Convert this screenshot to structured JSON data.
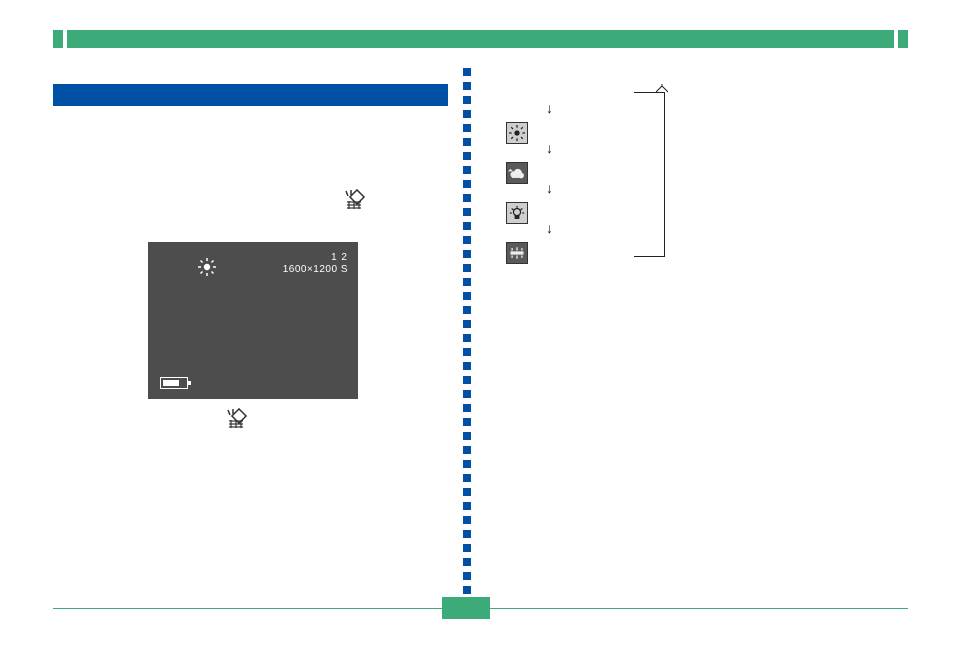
{
  "header": {
    "title_text": ""
  },
  "section_heading": {
    "text": ""
  },
  "left_column": {
    "wb_button_icon": "white-balance-button",
    "lcd": {
      "mode_icon": "daylight-sun",
      "shots_remaining": "1 2",
      "resolution": "1600×1200 S",
      "battery_icon": "battery-two-thirds"
    }
  },
  "right_column": {
    "return_arrow": "↵",
    "modes": [
      {
        "icon": "daylight-sun",
        "theme": "light",
        "down_arrow": "↓"
      },
      {
        "icon": "cloudy",
        "theme": "dark",
        "down_arrow": "↓"
      },
      {
        "icon": "tungsten",
        "theme": "light",
        "down_arrow": "↓"
      },
      {
        "icon": "fluorescent",
        "theme": "dark",
        "down_arrow": "↓"
      }
    ]
  },
  "footer": {
    "page_number": ""
  }
}
